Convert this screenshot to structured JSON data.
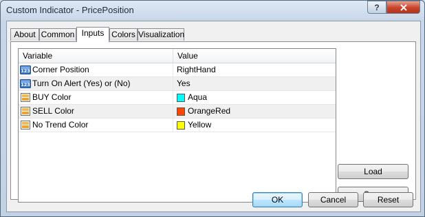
{
  "window": {
    "title": "Custom Indicator - PricePosition",
    "help_label": "?",
    "close_label": "X"
  },
  "tabs": [
    {
      "label": "About"
    },
    {
      "label": "Common"
    },
    {
      "label": "Inputs",
      "active": true
    },
    {
      "label": "Colors"
    },
    {
      "label": "Visualization"
    }
  ],
  "table": {
    "headers": {
      "variable": "Variable",
      "value": "Value"
    },
    "rows": [
      {
        "variable": "Corner Position",
        "value": "RightHand",
        "icon": "numeric-123-icon"
      },
      {
        "variable": "Turn On Alert (Yes) or (No)",
        "value": "Yes",
        "icon": "numeric-123-icon"
      },
      {
        "variable": "BUY Color",
        "value": "Aqua",
        "icon": "color-icon",
        "swatch": "#00ffff"
      },
      {
        "variable": "SELL Color",
        "value": "OrangeRed",
        "icon": "color-icon",
        "swatch": "#ff4500"
      },
      {
        "variable": "No Trend Color",
        "value": "Yellow",
        "icon": "color-icon",
        "swatch": "#ffff00"
      }
    ]
  },
  "side_buttons": {
    "load": "Load",
    "save": "Save"
  },
  "footer_buttons": {
    "ok": "OK",
    "cancel": "Cancel",
    "reset": "Reset"
  }
}
